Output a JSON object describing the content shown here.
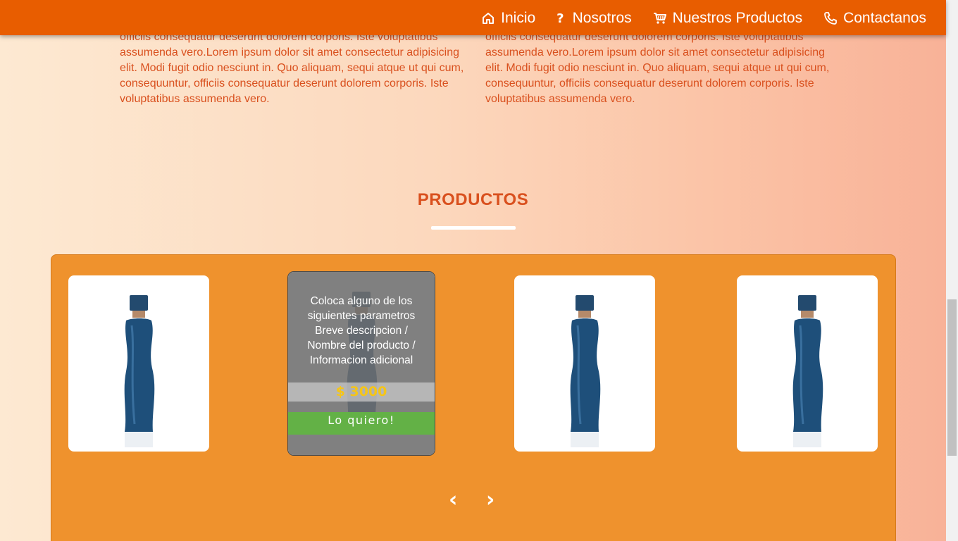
{
  "nav": {
    "items": [
      {
        "label": "Inicio",
        "icon": "home-icon"
      },
      {
        "label": "Nosotros",
        "icon": "question-icon"
      },
      {
        "label": "Nuestros Productos",
        "icon": "cart-icon"
      },
      {
        "label": "Contactanos",
        "icon": "phone-icon"
      }
    ]
  },
  "about": {
    "left_text": "officiis consequatur deserunt dolorem corporis. Iste voluptatibus assumenda vero.Lorem ipsum dolor sit amet consectetur adipisicing elit. Modi fugit odio nesciunt in. Quo aliquam, sequi atque ut qui cum, consequuntur, officiis consequatur deserunt dolorem corporis. Iste voluptatibus assumenda vero.",
    "right_text": "officiis consequatur deserunt dolorem corporis. Iste voluptatibus assumenda vero.Lorem ipsum dolor sit amet consectetur adipisicing elit. Modi fugit odio nesciunt in. Quo aliquam, sequi atque ut qui cum, consequuntur, officiis consequatur deserunt dolorem corporis. Iste voluptatibus assumenda vero."
  },
  "products": {
    "title": "PRODUCTOS",
    "hover_card": {
      "description": "Coloca alguno de los siguientes parametros Breve descripcion / Nombre del producto / Informacion adicional",
      "price": "$ 3000",
      "button": "Lo quiero!"
    },
    "prev_arrow": "‹",
    "next_arrow": "›"
  },
  "colors": {
    "navbar": "#e85d00",
    "text_accent": "#d9501e",
    "carousel_bg": "#ef922d",
    "price": "#f5c518",
    "buy_button": "#63b146"
  }
}
